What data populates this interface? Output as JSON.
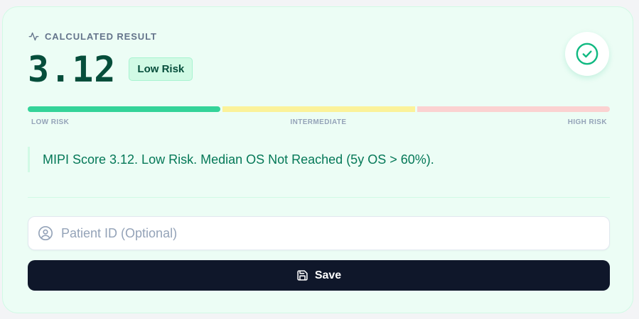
{
  "result": {
    "label": "CALCULATED RESULT",
    "score": "3.12",
    "badge": "Low Risk",
    "status_icon": "check-circle-icon"
  },
  "risk_bar": {
    "labels": [
      "LOW RISK",
      "INTERMEDIATE",
      "HIGH RISK"
    ],
    "active_segment": "low",
    "colors": {
      "low": "#34d399",
      "intermediate": "#fef08a",
      "high": "#fecaca"
    }
  },
  "interpretation": "MIPI Score 3.12. Low Risk. Median OS Not Reached (5y OS > 60%).",
  "patient_id": {
    "value": "",
    "placeholder": "Patient ID (Optional)"
  },
  "save_button": {
    "label": "Save",
    "icon": "save-icon"
  },
  "colors": {
    "accent": "#10b981",
    "card_bg": "#ecfdf5",
    "button_bg": "#0f172a"
  }
}
